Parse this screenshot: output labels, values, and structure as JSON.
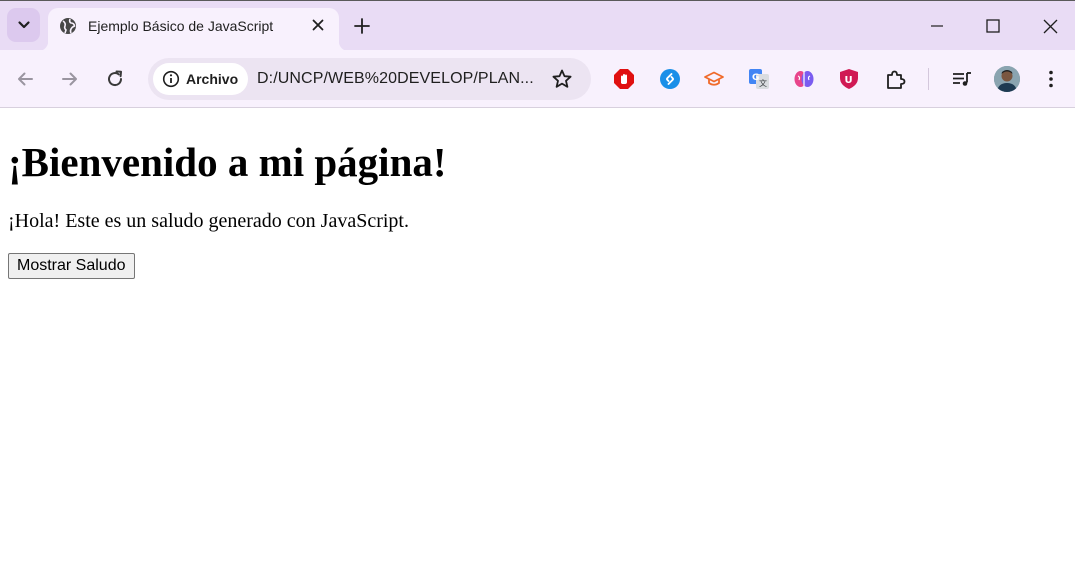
{
  "browser": {
    "tab": {
      "title": "Ejemplo Básico de JavaScript",
      "favicon": "globe-icon"
    },
    "address_bar": {
      "chip_label": "Archivo",
      "url": "D:/UNCP/WEB%20DEVELOP/PLAN..."
    },
    "extensions": [
      "adblock-icon",
      "shazam-icon",
      "graduation-cap-icon",
      "google-translate-icon",
      "brain-icon",
      "ublock-icon",
      "puzzle-icon"
    ],
    "colors": {
      "tabstrip": "#e9dcf5",
      "toolbar": "#f8f1fd",
      "omnibox": "#ece4f2"
    }
  },
  "page": {
    "heading": "¡Bienvenido a mi página!",
    "paragraph": "¡Hola! Este es un saludo generado con JavaScript.",
    "button_label": "Mostrar Saludo"
  }
}
